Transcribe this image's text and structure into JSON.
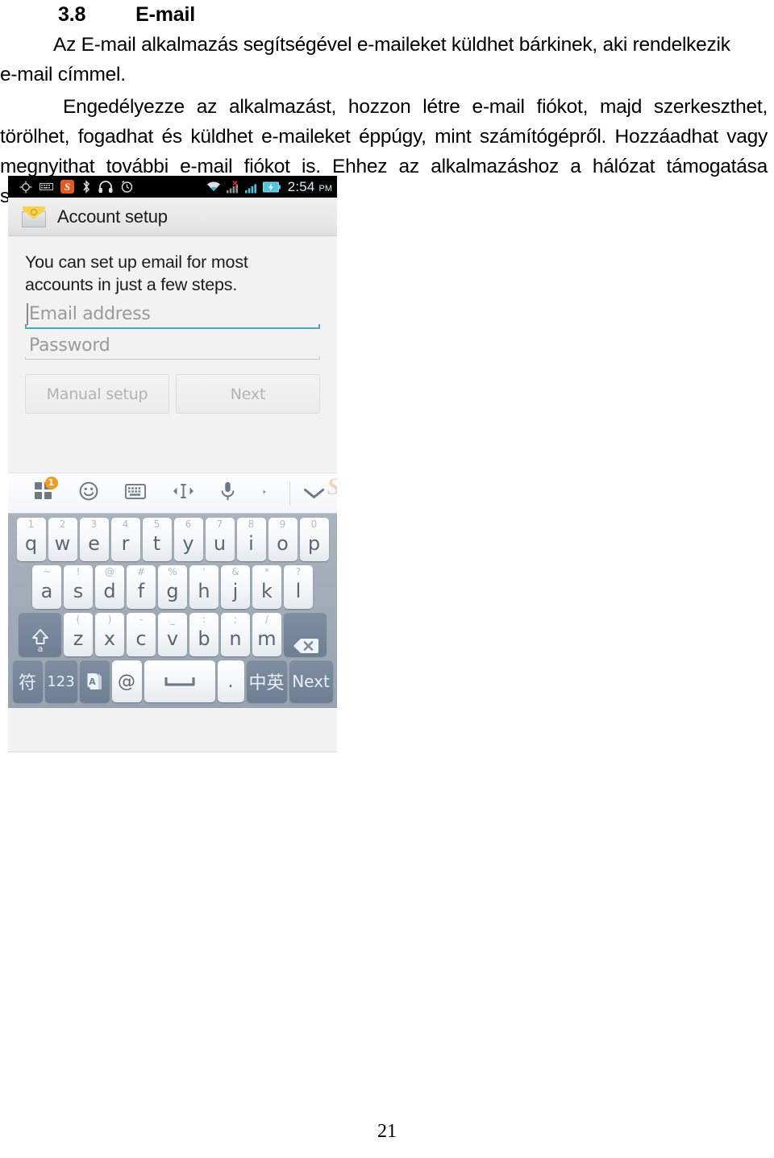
{
  "document": {
    "heading_number": "3.8",
    "heading_title": "E-mail",
    "paragraph_1": "Az E-mail alkalmazás segítségével e-maileket küldhet bárkinek, aki rendelkezik e-mail címmel.",
    "paragraph_2": "Engedélyezze az alkalmazást, hozzon létre e-mail fiókot, majd szerkeszthet, törölhet, fogadhat és küldhet e-maileket éppúgy, mint számítógépről. Hozzáadhat vagy megnyithat további e-mail fiókot is. Ehhez az alkalmazáshoz a hálózat támogatása szükséges.",
    "page_number": "21"
  },
  "phone": {
    "statusbar": {
      "time": "2:54",
      "ampm": "PM",
      "sogou_label": "S",
      "icons": [
        "gps-location-icon",
        "keyboard-input-icon",
        "sogou-ime-icon",
        "bluetooth-icon",
        "headset-icon",
        "alarm-clock-icon",
        "wifi-icon",
        "signal-sim1-no-service-icon",
        "signal-sim2-icon",
        "battery-charging-icon"
      ]
    },
    "actionbar": {
      "icon": "email-envelope-icon",
      "title": "Account setup"
    },
    "content": {
      "intro": "You can set up email for most accounts in just a few steps.",
      "email_placeholder": "Email address",
      "email_value": "",
      "password_placeholder": "Password",
      "password_value": "",
      "manual_setup_label": "Manual setup",
      "next_label": "Next",
      "accent_color": "#4aa8bd",
      "disabled_text_color": "#b3b3b3"
    },
    "ime_toolbar": {
      "badge_count": "1",
      "items": [
        "apps-grid-icon",
        "emoji-smiley-icon",
        "keyboard-layout-icon",
        "cursor-move-icon",
        "microphone-voice-icon",
        "more-arrow-icon",
        "collapse-keyboard-icon"
      ],
      "watermark": "S"
    },
    "keyboard": {
      "row1": [
        {
          "alt": "1",
          "key": "q"
        },
        {
          "alt": "2",
          "key": "w"
        },
        {
          "alt": "3",
          "key": "e"
        },
        {
          "alt": "4",
          "key": "r"
        },
        {
          "alt": "5",
          "key": "t"
        },
        {
          "alt": "6",
          "key": "y"
        },
        {
          "alt": "7",
          "key": "u"
        },
        {
          "alt": "8",
          "key": "i"
        },
        {
          "alt": "9",
          "key": "o"
        },
        {
          "alt": "0",
          "key": "p"
        }
      ],
      "row2": [
        {
          "alt": "~",
          "key": "a"
        },
        {
          "alt": "!",
          "key": "s"
        },
        {
          "alt": "@",
          "key": "d"
        },
        {
          "alt": "#",
          "key": "f"
        },
        {
          "alt": "%",
          "key": "g"
        },
        {
          "alt": "'",
          "key": "h"
        },
        {
          "alt": "&",
          "key": "j"
        },
        {
          "alt": "*",
          "key": "k"
        },
        {
          "alt": "?",
          "key": "l"
        }
      ],
      "row3": [
        {
          "alt": "",
          "key": "",
          "name": "shift-key",
          "icon": "shift-arrow-a-icon"
        },
        {
          "alt": "(",
          "key": "z"
        },
        {
          "alt": ")",
          "key": "x"
        },
        {
          "alt": "-",
          "key": "c"
        },
        {
          "alt": "_",
          "key": "v"
        },
        {
          "alt": ":",
          "key": "b"
        },
        {
          "alt": ";",
          "key": "n"
        },
        {
          "alt": "/",
          "key": "m"
        },
        {
          "alt": "",
          "key": "",
          "name": "backspace-key",
          "icon": "backspace-icon"
        }
      ],
      "row4": [
        {
          "key": "符",
          "name": "symbols-key"
        },
        {
          "key": "123",
          "name": "numbers-key"
        },
        {
          "key": "",
          "name": "app-switch-key",
          "icon": "ime-app-icon"
        },
        {
          "key": "@",
          "name": "at-key"
        },
        {
          "key": "",
          "name": "space-key",
          "icon": "space-bar-icon"
        },
        {
          "key": ".",
          "name": "period-key"
        },
        {
          "key": "中英",
          "name": "language-toggle-key"
        },
        {
          "key": "Next",
          "name": "next-key"
        }
      ]
    }
  }
}
